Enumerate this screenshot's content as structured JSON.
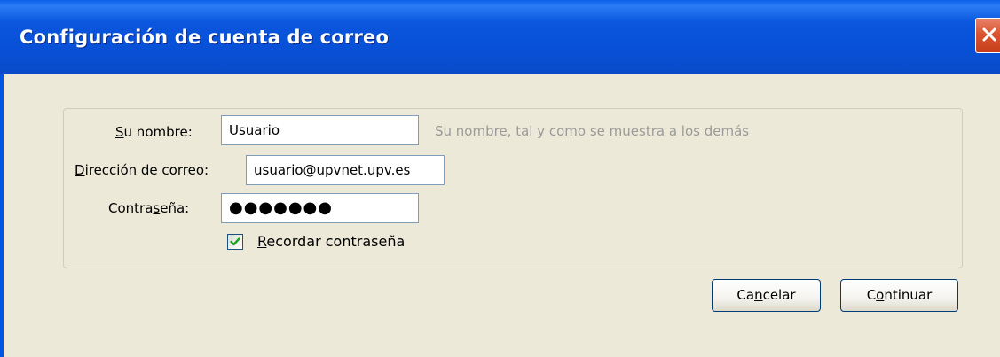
{
  "window": {
    "title": "Configuración de cuenta de correo"
  },
  "form": {
    "name": {
      "label_prefix": "",
      "label_accel": "S",
      "label_rest": "u nombre:",
      "value": "Usuario",
      "hint": "Su nombre, tal y como se muestra a los demás"
    },
    "email": {
      "label_prefix": "",
      "label_accel": "D",
      "label_rest": "irección de correo:",
      "value": "usuario@upvnet.upv.es"
    },
    "password": {
      "label_prefix": "Contra",
      "label_accel": "s",
      "label_rest": "eña:",
      "value": "●●●●●●●"
    },
    "remember": {
      "checked": true,
      "label_accel": "R",
      "label_rest": "ecordar contraseña"
    }
  },
  "buttons": {
    "cancel": {
      "prefix": "Ca",
      "accel": "n",
      "rest": "celar"
    },
    "continue": {
      "prefix": "C",
      "accel": "o",
      "rest": "ntinuar"
    }
  },
  "colors": {
    "titlebar": "#0a56dd",
    "window_bg": "#ece9d8",
    "close": "#d9552f",
    "hint": "#9a9a9a"
  }
}
